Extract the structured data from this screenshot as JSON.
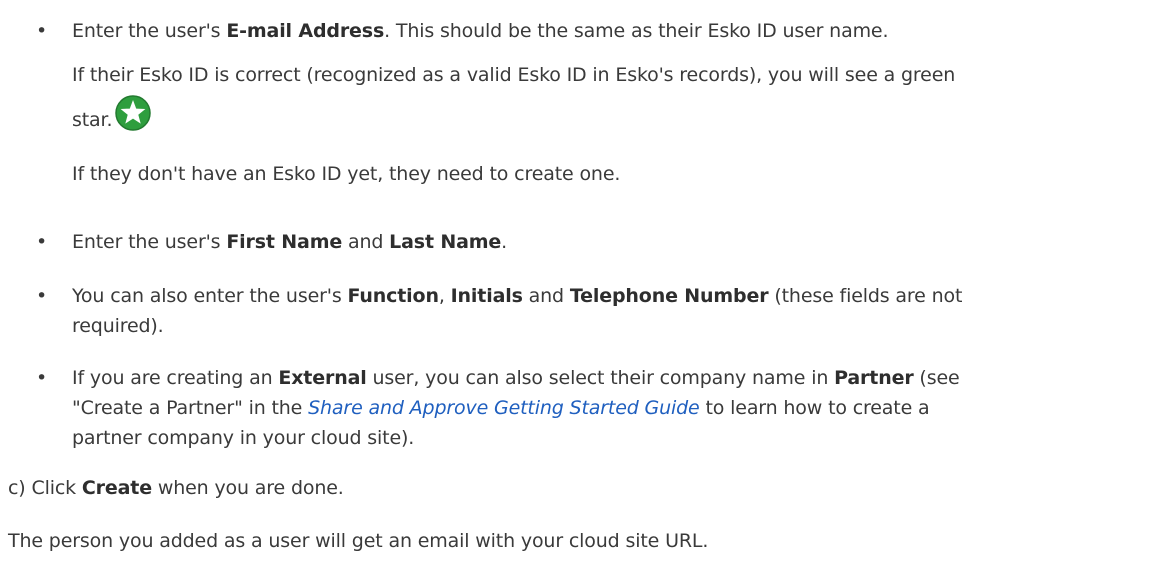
{
  "bullets": [
    {
      "pre": "Enter the user's ",
      "bold1": "E-mail Address",
      "post": ". This should be the same as their Esko ID user name."
    },
    {
      "pre": "Enter the user's ",
      "bold1": "First Name",
      "mid": " and ",
      "bold2": "Last Name",
      "post": "."
    },
    {
      "pre": "You can also enter the user's ",
      "bold1": "Function",
      "mid1": ", ",
      "bold2": "Initials",
      "mid2": " and ",
      "bold3": "Telephone Number",
      "post_line1": " (these fields are not",
      "post_line2": "required)."
    },
    {
      "pre": "If you are creating an ",
      "bold1": "External",
      "mid1": " user, you can also select their company name in ",
      "bold2": "Partner",
      "mid2": " (see",
      "line2_pre": "\"Create a Partner\" in the ",
      "link": "Share and Approve Getting Started Guide",
      "line2_post": " to learn how to create a",
      "line3": "partner company in your cloud site)."
    }
  ],
  "esko_id_note": {
    "line1": "If their Esko ID is correct (recognized as a valid Esko ID in Esko's records), you will see a green",
    "line2": "star.",
    "star_icon": "green-star-icon",
    "star_color": "#2e9e3e"
  },
  "no_id_note": "If they don't have an Esko ID yet, they need to create one.",
  "step_c": {
    "marker": "c)",
    "pre": " Click ",
    "bold": "Create",
    "post": " when you are done."
  },
  "final_note": "The person you added as a user will get an email with your cloud site URL."
}
